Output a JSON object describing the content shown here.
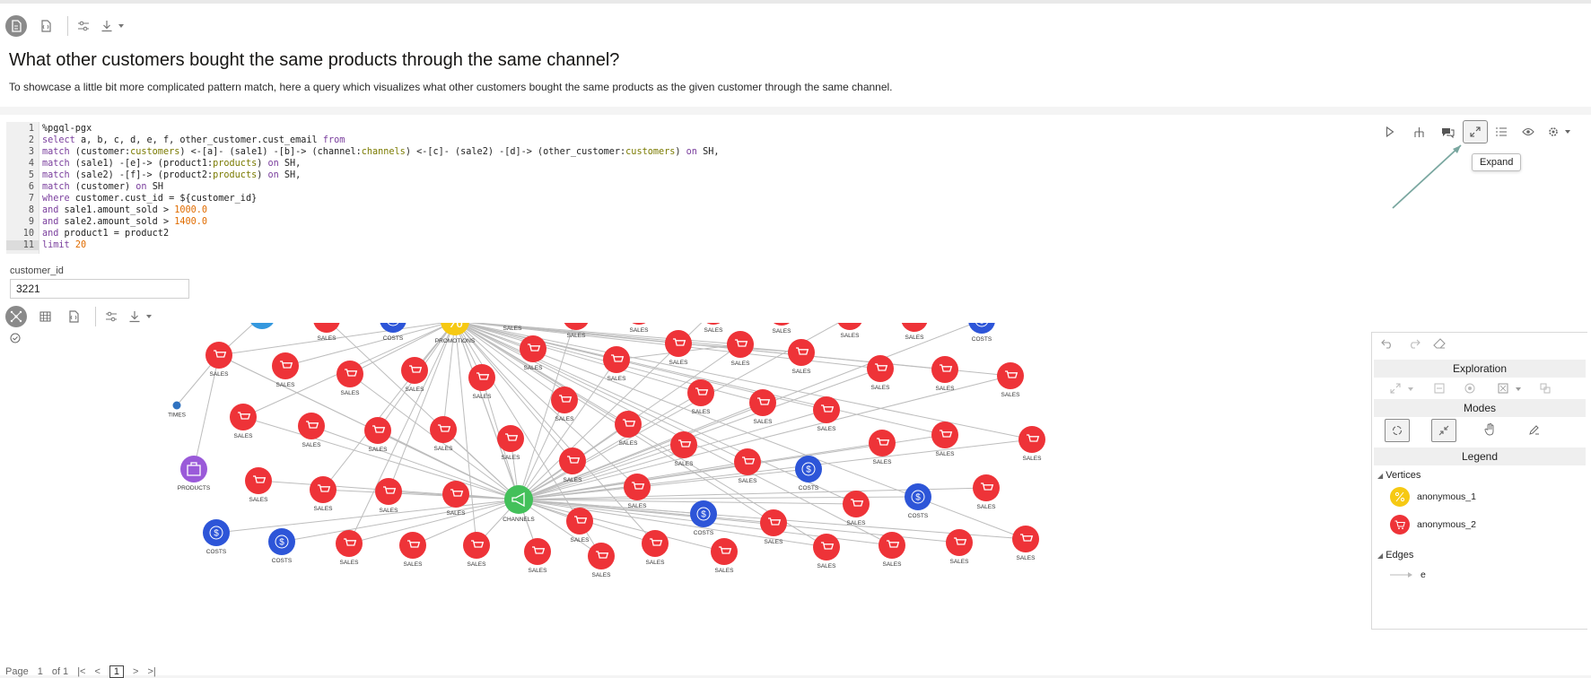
{
  "header": {
    "icons": [
      "paragraph-icon",
      "script-icon",
      "settings-icon",
      "download-icon"
    ]
  },
  "paragraph": {
    "title": "What other customers bought the same products through the same channel?",
    "description": "To showcase a little bit more complicated pattern match, here a query which visualizes what other customers bought the same products as the given customer through the same channel."
  },
  "editor": {
    "line_numbers": [
      "1",
      "2",
      "3",
      "4",
      "5",
      "6",
      "7",
      "8",
      "9",
      "10",
      "11"
    ],
    "lines": [
      "%pgql-pgx",
      "select a, b, c, d, e, f, other_customer.cust_email from",
      "match (customer:customers) <-[a]- (sale1) -[b]-> (channel:channels) <-[c]- (sale2) -[d]-> (other_customer:customers) on SH,",
      "match (sale1) -[e]-> (product1:products) on SH,",
      "match (sale2) -[f]-> (product2:products) on SH,",
      "match (customer) on SH",
      "where customer.cust_id = ${customer_id}",
      "and sale1.amount_sold > 1000.0",
      "and sale2.amount_sold > 1400.0",
      "and product1 = product2",
      "limit 20"
    ]
  },
  "code_toolbar": {
    "tooltip": "Expand",
    "icons": [
      "run-icon",
      "graph-icon",
      "comments-icon",
      "expand-icon",
      "list-icon",
      "eye-icon",
      "gear-icon"
    ]
  },
  "param": {
    "label": "customer_id",
    "value": "3221"
  },
  "graph_toolbar": {
    "icons": [
      "graph-view-icon",
      "table-icon",
      "script-icon",
      "settings-icon",
      "download-icon"
    ]
  },
  "graph": {
    "labels": {
      "sales": "SALES",
      "costs": "COSTS",
      "promotions": "PROMOTIONS",
      "channels": "CHANNELS",
      "products": "PRODUCTS",
      "times": "TIMES"
    },
    "colors": {
      "sales": "#ee3338",
      "costs": "#2d55d8",
      "promotions": "#f6c913",
      "channels": "#43c05a",
      "products": "#9a5ad9",
      "customers": "#3498de",
      "times": "#2f72c0",
      "edge": "#bdbdbd"
    }
  },
  "panel": {
    "exploration": "Exploration",
    "modes": "Modes",
    "legend": "Legend",
    "vertices_label": "Vertices",
    "edges_label": "Edges",
    "vertices": [
      {
        "label": "anonymous_1",
        "color": "#f6c913"
      },
      {
        "label": "anonymous_2",
        "color": "#ee3338"
      }
    ],
    "edge_item": "e"
  },
  "pager": {
    "page_label": "Page",
    "current": "1",
    "of_label": "of 1",
    "page_box": "1"
  }
}
